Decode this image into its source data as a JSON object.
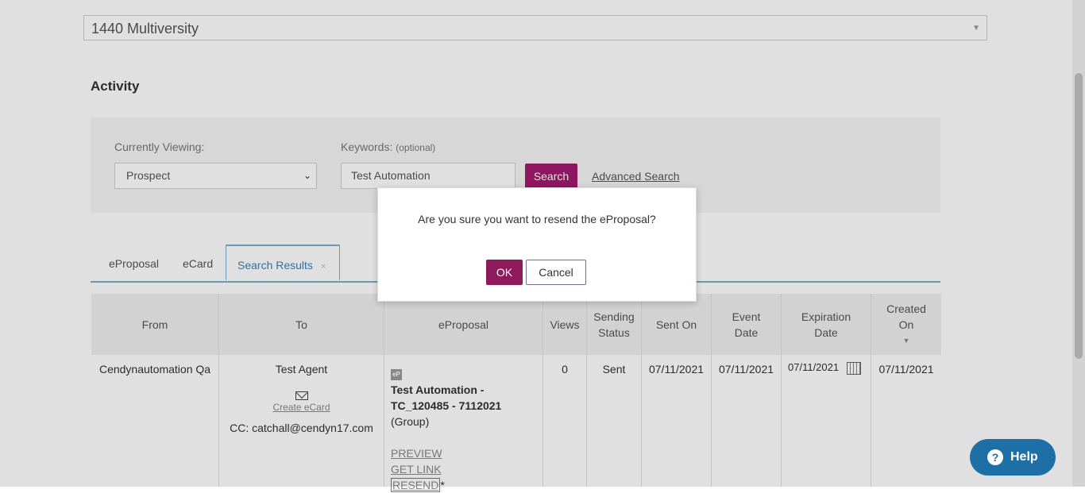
{
  "property_select": {
    "value": "1440 Multiversity"
  },
  "activity": {
    "title": "Activity"
  },
  "filters": {
    "viewing_label": "Currently Viewing:",
    "viewing_value": "Prospect",
    "keywords_label": "Keywords:",
    "keywords_optional": "(optional)",
    "keywords_value": "Test Automation",
    "search_label": "Search",
    "advanced_label": "Advanced Search"
  },
  "tabs": [
    {
      "label": "eProposal"
    },
    {
      "label": "eCard"
    },
    {
      "label": "Search Results"
    }
  ],
  "table": {
    "headers": {
      "from": "From",
      "to": "To",
      "eproposal": "eProposal",
      "views": "Views",
      "sending_status": "Sending Status",
      "sent_on": "Sent On",
      "event_date": "Event Date",
      "expiration_date": "Expiration Date",
      "created_on": "Created On"
    },
    "row": {
      "from": "Cendynautomation Qa",
      "to": "Test Agent",
      "create_ecard": "Create eCard",
      "cc": "CC:  catchall@cendyn17.com",
      "ep_badge": "eP",
      "title": "Test Automation - TC_120485 - 7112021",
      "group": "(Group)",
      "preview": "PREVIEW",
      "get_link": "GET LINK",
      "resend": "RESEND",
      "resend_mark": "*",
      "views": "0",
      "status": "Sent",
      "sent_on": "07/11/2021",
      "event_date": "07/11/2021",
      "expiration_date": "07/11/2021",
      "created_on": "07/11/2021"
    }
  },
  "dialog": {
    "message": "Are you sure you want to resend the eProposal?",
    "ok": "OK",
    "cancel": "Cancel"
  },
  "help": {
    "label": "Help",
    "icon": "question-icon"
  },
  "colors": {
    "primary": "#a31a6f",
    "ok": "#8c1a5c",
    "help": "#1f6fa7",
    "tab_accent": "#7aaed0"
  }
}
